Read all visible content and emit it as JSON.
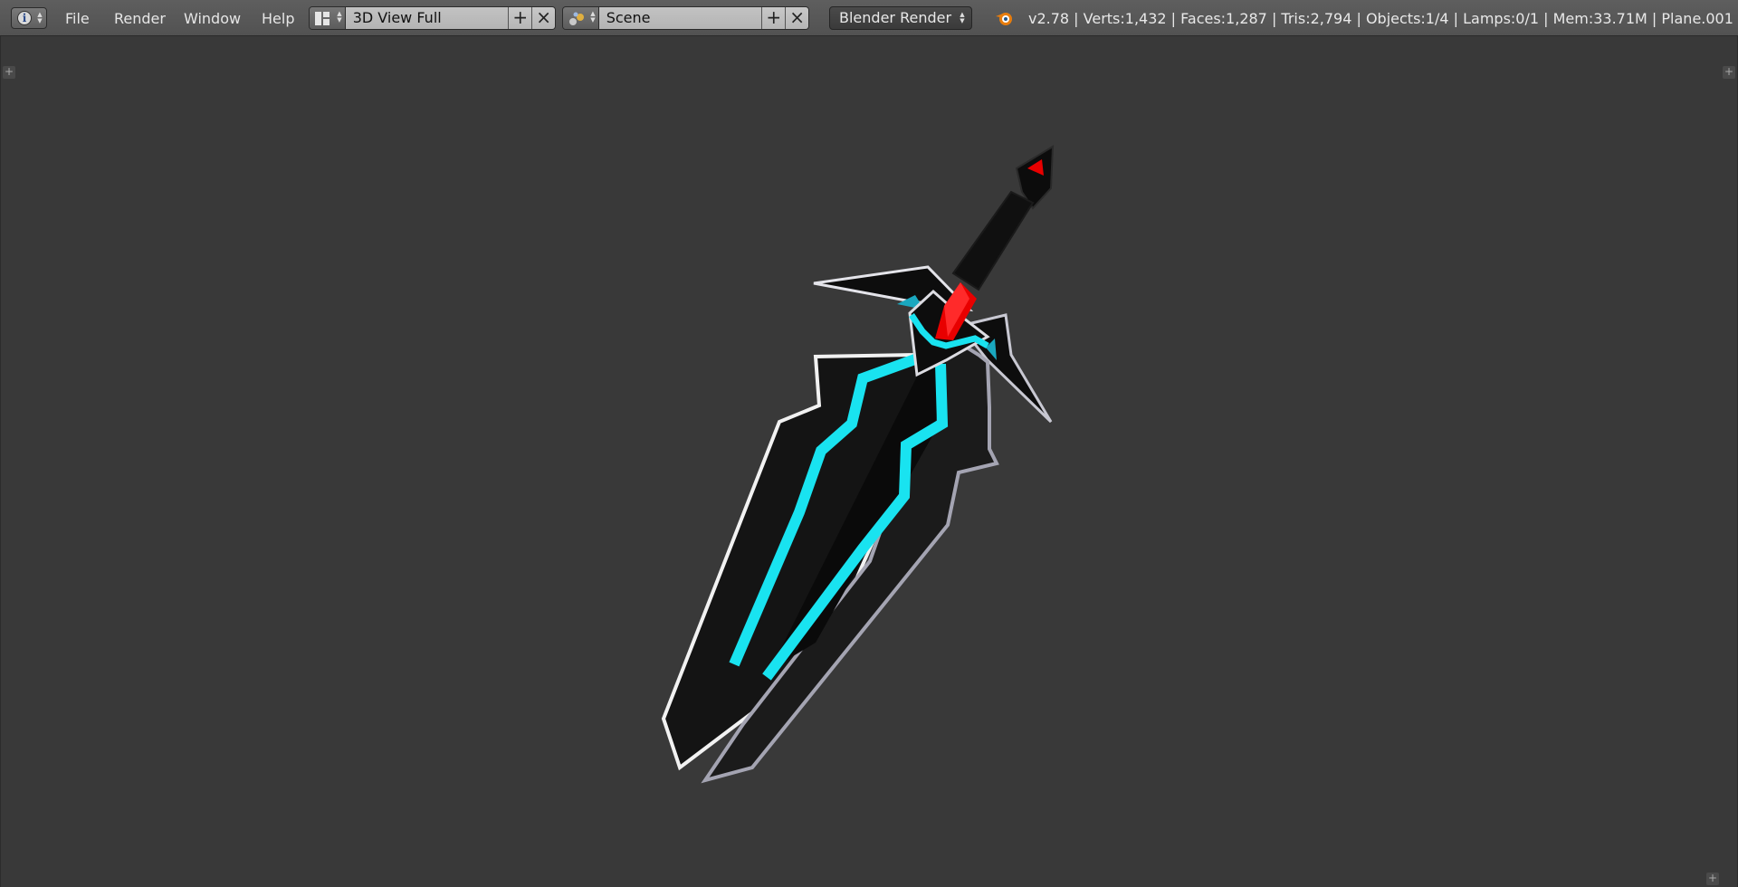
{
  "header": {
    "editor_type_icon": "info-icon",
    "menus": [
      "File",
      "Render",
      "Window",
      "Help"
    ],
    "screen_layout": {
      "icon": "screen-layout-icon",
      "value": "3D View Full",
      "add_icon": "plus-icon",
      "remove_icon": "x-icon"
    },
    "scene": {
      "icon": "scene-icon",
      "value": "Scene",
      "add_icon": "plus-icon",
      "remove_icon": "x-icon"
    },
    "render_engine": "Blender Render",
    "blender_logo_icon": "blender-logo-icon",
    "stats": "v2.78 | Verts:1,432 | Faces:1,287 | Tris:2,794 | Objects:1/4 | Lamps:0/1 | Mem:33.71M | Plane.001"
  },
  "viewport": {
    "background_color": "#393939",
    "model": "sword",
    "colors": {
      "blade": "#111111",
      "glow": "#19e3f0",
      "gem": "#e80000",
      "edge": "#d8d8e0"
    }
  }
}
